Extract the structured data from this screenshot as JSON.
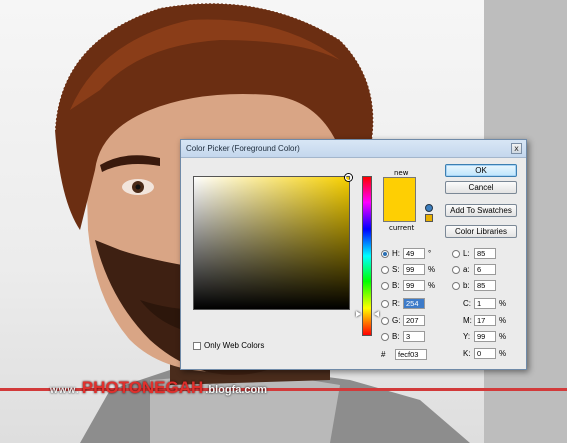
{
  "dialog": {
    "title": "Color Picker (Foreground Color)",
    "close_glyph": "x",
    "new_label": "new",
    "current_label": "current",
    "only_web_colors": "Only Web Colors"
  },
  "buttons": {
    "ok": "OK",
    "cancel": "Cancel",
    "add_to_swatches": "Add To Swatches",
    "color_libraries": "Color Libraries"
  },
  "hsb": [
    {
      "label": "H:",
      "value": "49",
      "unit": "°",
      "checked": true
    },
    {
      "label": "S:",
      "value": "99",
      "unit": "%"
    },
    {
      "label": "B:",
      "value": "99",
      "unit": "%"
    }
  ],
  "rgb": [
    {
      "label": "R:",
      "value": "254"
    },
    {
      "label": "G:",
      "value": "207"
    },
    {
      "label": "B:",
      "value": "3"
    }
  ],
  "lab": [
    {
      "label": "L:",
      "value": "85"
    },
    {
      "label": "a:",
      "value": "6"
    },
    {
      "label": "b:",
      "value": "85"
    }
  ],
  "cmyk": [
    {
      "label": "C:",
      "value": "1",
      "unit": "%"
    },
    {
      "label": "M:",
      "value": "17",
      "unit": "%"
    },
    {
      "label": "Y:",
      "value": "99",
      "unit": "%"
    },
    {
      "label": "K:",
      "value": "0",
      "unit": "%"
    }
  ],
  "hex": {
    "label": "#",
    "value": "fecf03"
  },
  "colors": {
    "selected": "#fecf03",
    "hue_base": "#f7d000",
    "watermark_red": "#e0302c"
  },
  "watermark": {
    "prefix": "www.",
    "brand": "PHOTONEGAH",
    "suffix": ".blogfa.com"
  }
}
